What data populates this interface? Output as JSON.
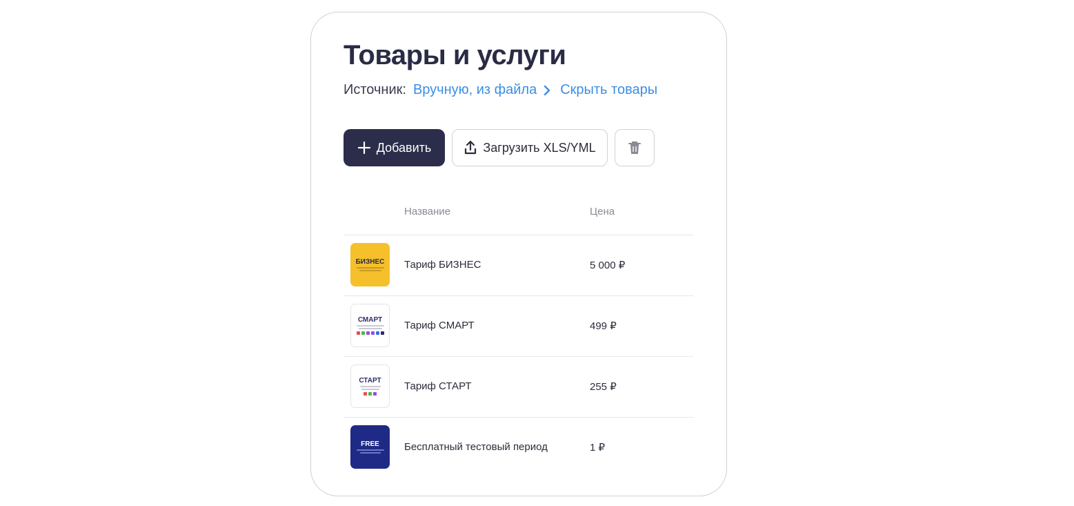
{
  "title": "Товары и услуги",
  "source": {
    "label": "Источник:",
    "link": "Вручную, из файла",
    "hide": "Скрыть товары"
  },
  "toolbar": {
    "add_label": "Добавить",
    "upload_label": "Загрузить XLS/YML"
  },
  "table": {
    "headers": {
      "name": "Название",
      "price": "Цена"
    },
    "rows": [
      {
        "thumb": "БИЗНЕС",
        "name": "Тариф БИЗНЕС",
        "price": "5 000 ₽"
      },
      {
        "thumb": "СМАРТ",
        "name": "Тариф СМАРТ",
        "price": "499 ₽"
      },
      {
        "thumb": "СТАРТ",
        "name": "Тариф СТАРТ",
        "price": "255 ₽"
      },
      {
        "thumb": "FREE",
        "name": "Бесплатный тестовый период",
        "price": "1 ₽"
      }
    ]
  },
  "colors": {
    "primary": "#2b2d4a",
    "link": "#3a8ee6",
    "business_tile": "#f5c02c",
    "free_tile": "#1f2a86"
  },
  "icons": [
    "plus-icon",
    "upload-icon",
    "trash-icon",
    "chevron-right-icon"
  ]
}
